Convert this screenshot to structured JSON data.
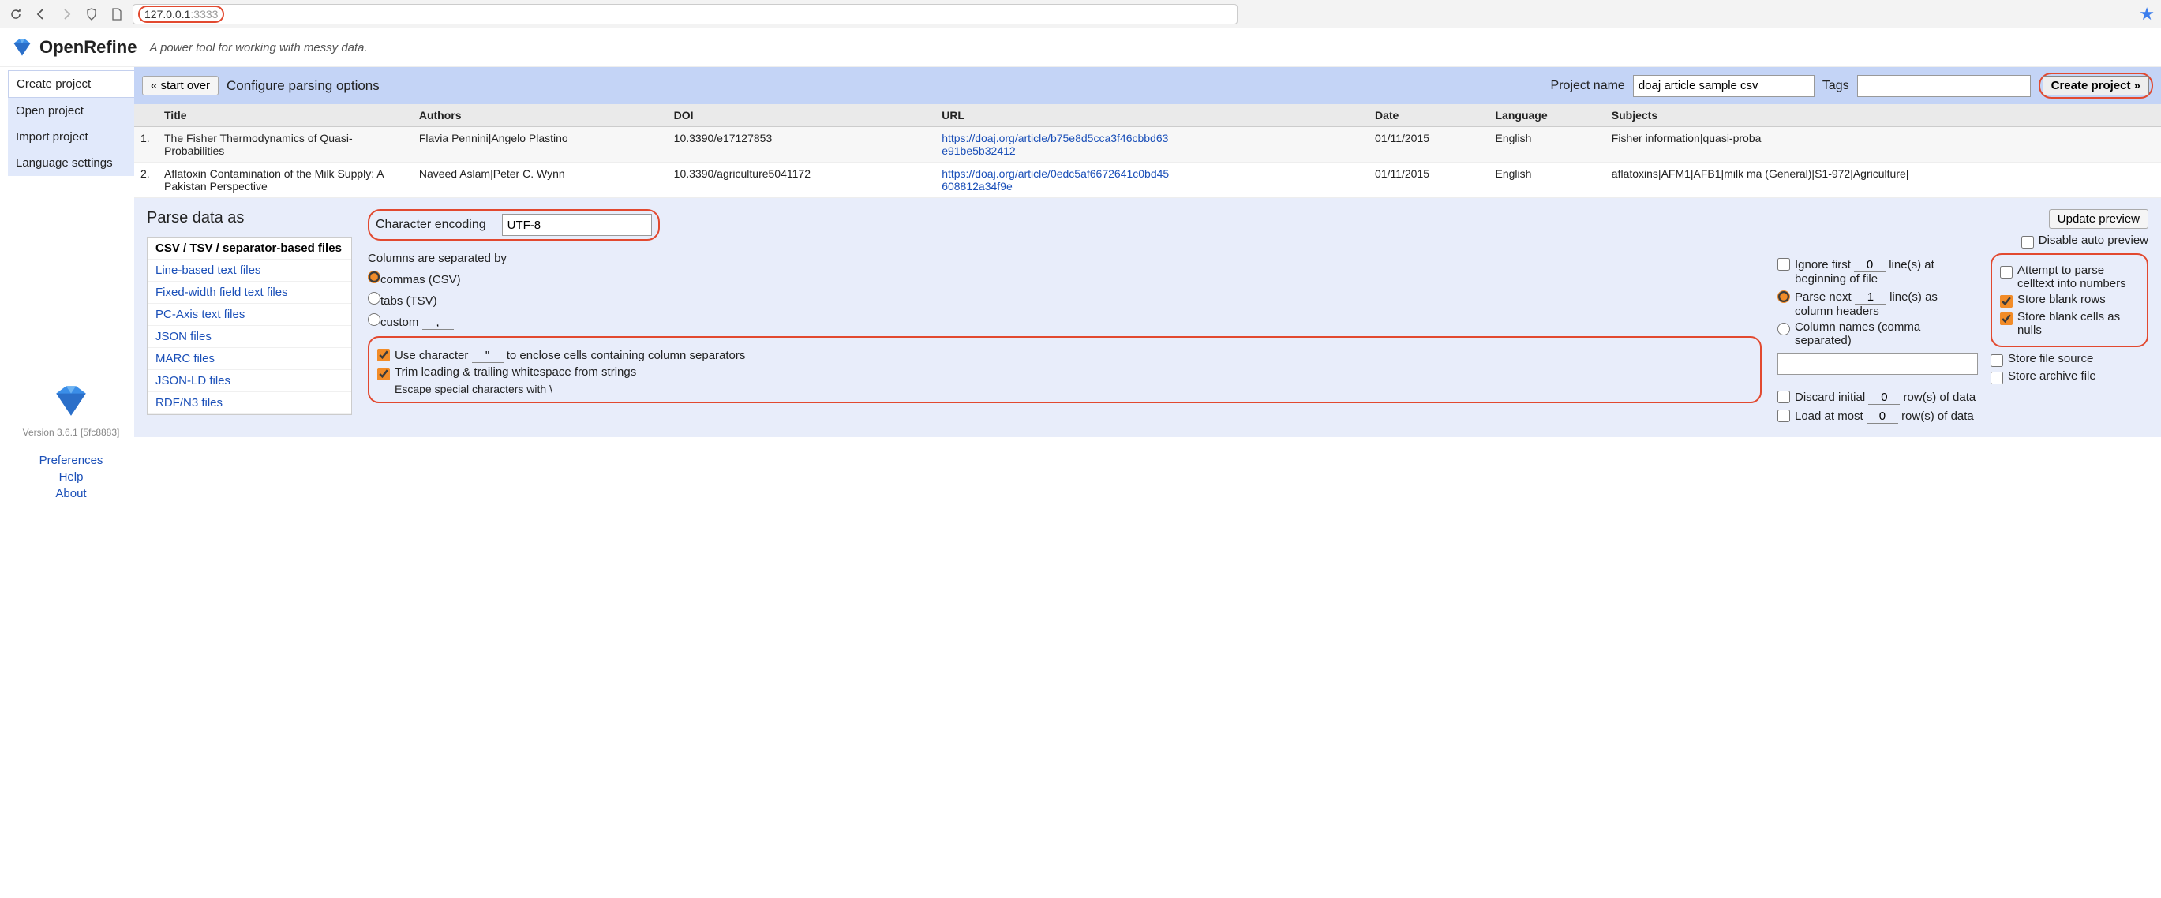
{
  "browser": {
    "url_host": "127.0.0.1",
    "url_port": ":3333"
  },
  "app": {
    "title": "OpenRefine",
    "tagline": "A power tool for working with messy data."
  },
  "sidebar": {
    "tabs": [
      "Create project",
      "Open project",
      "Import project",
      "Language settings"
    ],
    "version": "Version 3.6.1 [5fc8883]",
    "links": [
      "Preferences",
      "Help",
      "About"
    ]
  },
  "toolbar": {
    "start_over": "« start over",
    "title": "Configure parsing options",
    "project_name_label": "Project name",
    "project_name_value": "doaj article sample csv",
    "tags_label": "Tags",
    "create_project": "Create project »"
  },
  "columns": [
    "Title",
    "Authors",
    "DOI",
    "URL",
    "Date",
    "Language",
    "Subjects"
  ],
  "rows": [
    {
      "n": "1.",
      "title": "The Fisher Thermodynamics of Quasi-Probabilities",
      "authors": "Flavia Pennini|Angelo Plastino",
      "doi": "10.3390/e17127853",
      "url": "https://doaj.org/article/b75e8d5cca3f46cbbd63e91be5b32412",
      "date": "01/11/2015",
      "language": "English",
      "subjects": "Fisher information|quasi-proba"
    },
    {
      "n": "2.",
      "title": "Aflatoxin Contamination of the Milk Supply: A Pakistan Perspective",
      "authors": "Naveed Aslam|Peter C. Wynn",
      "doi": "10.3390/agriculture5041172",
      "url": "https://doaj.org/article/0edc5af6672641c0bd45608812a34f9e",
      "date": "01/11/2015",
      "language": "English",
      "subjects": "aflatoxins|AFM1|AFB1|milk ma (General)|S1-972|Agriculture|"
    }
  ],
  "parse": {
    "heading": "Parse data as",
    "formats": [
      "CSV / TSV / separator-based files",
      "Line-based text files",
      "Fixed-width field text files",
      "PC-Axis text files",
      "JSON files",
      "MARC files",
      "JSON-LD files",
      "RDF/N3 files"
    ],
    "encoding_label": "Character encoding",
    "encoding_value": "UTF-8",
    "update_preview": "Update preview",
    "disable_auto_preview": "Disable auto preview",
    "sep_label": "Columns are separated by",
    "sep_commas": "commas (CSV)",
    "sep_tabs": "tabs (TSV)",
    "sep_custom": "custom",
    "sep_custom_value": ",",
    "enclose_a": "Use character",
    "enclose_char": "\"",
    "enclose_b": "to enclose cells containing column separators",
    "trim": "Trim leading & trailing whitespace from strings",
    "escape": "Escape special characters with \\",
    "ignore_first_a": "Ignore first",
    "ignore_first_val": "0",
    "ignore_first_b": "line(s) at beginning of file",
    "parse_next_a": "Parse next",
    "parse_next_val": "1",
    "parse_next_b": "line(s) as column headers",
    "col_names": "Column names (comma separated)",
    "discard_a": "Discard initial",
    "discard_val": "0",
    "discard_b": "row(s) of data",
    "load_a": "Load at most",
    "load_val": "0",
    "load_b": "row(s) of data",
    "attempt_parse": "Attempt to parse celltext into numbers",
    "store_blank_rows": "Store blank rows",
    "store_blank_cells": "Store blank cells as nulls",
    "store_file_source": "Store file source",
    "store_archive_file": "Store archive file"
  }
}
